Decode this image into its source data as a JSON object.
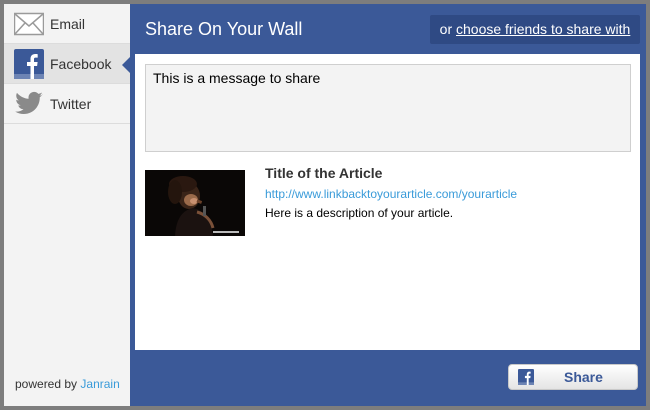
{
  "sidebar": {
    "items": [
      {
        "label": "Email",
        "icon": "envelope-icon"
      },
      {
        "label": "Facebook",
        "icon": "facebook-icon"
      },
      {
        "label": "Twitter",
        "icon": "twitter-icon"
      }
    ],
    "active_item": "Facebook",
    "powered_by": "powered by",
    "powered_link": "Janrain"
  },
  "header": {
    "title": "Share On Your Wall",
    "or_text": "or",
    "choose_link": "choose friends to share with"
  },
  "message": {
    "value": "This is a message to share"
  },
  "article": {
    "title": "Title of the Article",
    "url": "http://www.linkbacktoyourarticle.com/yourarticle",
    "description": "Here is a description of your article.",
    "thumbnail_icon": "article-thumbnail"
  },
  "share_button": {
    "label": "Share",
    "icon": "facebook-icon"
  },
  "colors": {
    "facebook_blue": "#3b5998",
    "link_blue": "#3a9bd9",
    "sidebar_bg": "#f3f3f3"
  }
}
